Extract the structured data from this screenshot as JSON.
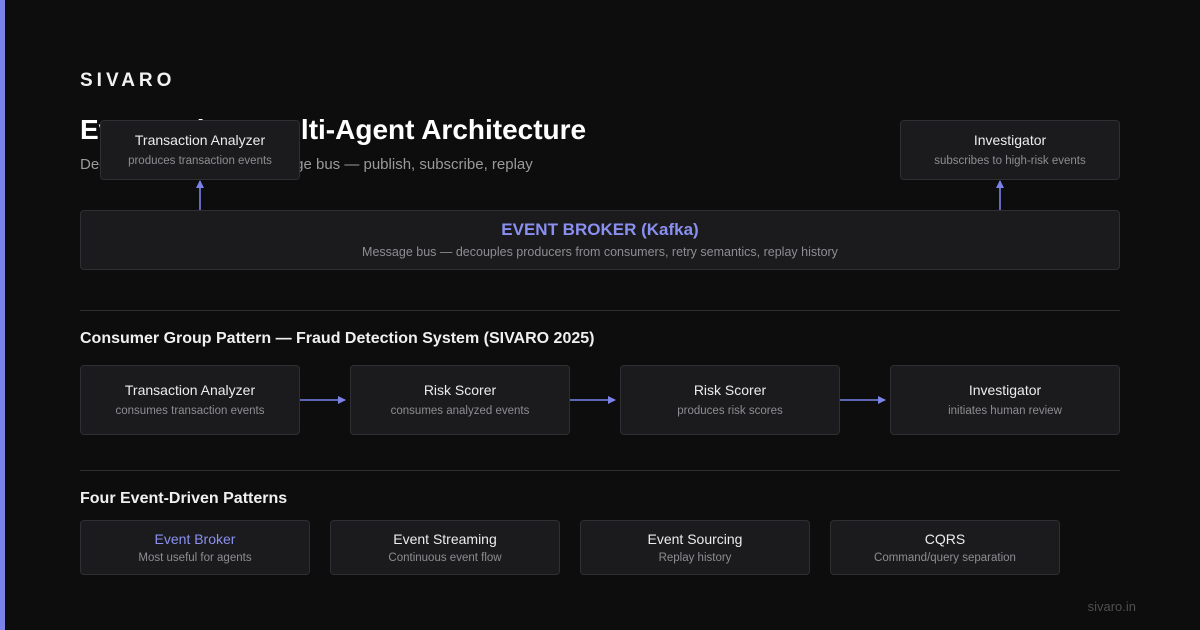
{
  "brand": "SIVARO",
  "title": "Event-Driven Multi-Agent Architecture",
  "subtitle": "Decoupled agents over a message bus — publish, subscribe, replay",
  "top": {
    "producer": {
      "name": "Transaction Analyzer",
      "desc": "produces transaction events"
    },
    "subscriber": {
      "name": "Investigator",
      "desc": "subscribes to high-risk events"
    },
    "broker": {
      "name": "EVENT BROKER (Kafka)",
      "desc": "Message bus — decouples producers from consumers, retry semantics, replay history"
    }
  },
  "consumer_section": {
    "title": "Consumer Group Pattern — Fraud Detection System (SIVARO 2025)",
    "steps": [
      {
        "name": "Transaction Analyzer",
        "desc": "consumes transaction events"
      },
      {
        "name": "Risk Scorer",
        "desc": "consumes analyzed events"
      },
      {
        "name": "Risk Scorer",
        "desc": "produces risk scores"
      },
      {
        "name": "Investigator",
        "desc": "initiates human review"
      }
    ]
  },
  "patterns_section": {
    "title": "Four Event-Driven Patterns",
    "items": [
      {
        "name": "Event Broker",
        "desc": "Most useful for agents"
      },
      {
        "name": "Event Streaming",
        "desc": "Continuous event flow"
      },
      {
        "name": "Event Sourcing",
        "desc": "Replay history"
      },
      {
        "name": "CQRS",
        "desc": "Command/query separation"
      }
    ]
  },
  "footer": "sivaro.in",
  "colors": {
    "accent": "#7b83e8",
    "background": "#0d0d0d",
    "box": "#1b1b1d",
    "border": "#2f2f33"
  }
}
